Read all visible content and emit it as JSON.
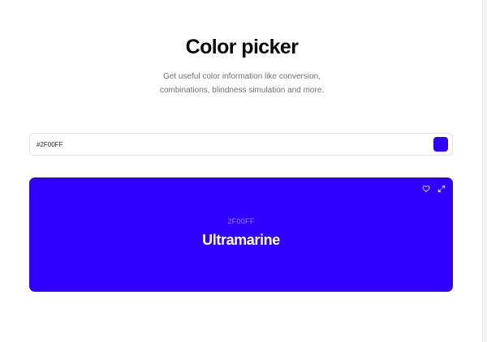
{
  "header": {
    "title": "Color picker",
    "subtitle_line1": "Get useful color information like conversion,",
    "subtitle_line2": "combinations, blindness simulation and more."
  },
  "picker": {
    "input_value": "#2F00FF",
    "swatch_color": "#2F00FF"
  },
  "color_card": {
    "hex": "2F00FF",
    "name": "Ultramarine",
    "background": "#2F00FF",
    "hex_text_color": "#9a8cff",
    "icons": [
      "heart-icon",
      "expand-icon"
    ]
  }
}
